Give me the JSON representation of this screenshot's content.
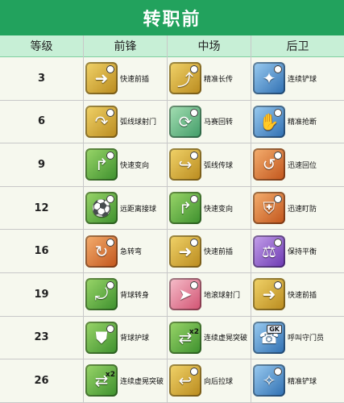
{
  "title": "转职前",
  "headers": {
    "level": "等级",
    "forward": "前锋",
    "midfield": "中场",
    "defense": "后卫"
  },
  "rows": [
    {
      "level": "3",
      "fw": {
        "label": "快速前插",
        "icon": "sprint-forward-icon",
        "color": "gold"
      },
      "mf": {
        "label": "精准长传",
        "icon": "long-pass-icon",
        "color": "gold"
      },
      "df": {
        "label": "连续铲球",
        "icon": "slide-tackle-icon",
        "color": "blue"
      }
    },
    {
      "level": "6",
      "fw": {
        "label": "弧线球射门",
        "icon": "curve-shot-icon",
        "color": "gold"
      },
      "mf": {
        "label": "马赛回转",
        "icon": "marseille-turn-icon",
        "color": "teal"
      },
      "df": {
        "label": "精准抢断",
        "icon": "steal-icon",
        "color": "blue"
      }
    },
    {
      "level": "9",
      "fw": {
        "label": "快速变向",
        "icon": "quick-turn-icon",
        "color": "green"
      },
      "mf": {
        "label": "弧线传球",
        "icon": "curve-pass-icon",
        "color": "gold"
      },
      "df": {
        "label": "迅速回位",
        "icon": "quick-return-icon",
        "color": "orange"
      }
    },
    {
      "level": "12",
      "fw": {
        "label": "远距离接球",
        "icon": "long-receive-icon",
        "color": "green"
      },
      "mf": {
        "label": "快速变向",
        "icon": "quick-turn-icon",
        "color": "green"
      },
      "df": {
        "label": "迅速盯防",
        "icon": "mark-icon",
        "color": "orange"
      }
    },
    {
      "level": "16",
      "fw": {
        "label": "急转弯",
        "icon": "sharp-turn-icon",
        "color": "orange"
      },
      "mf": {
        "label": "快速前插",
        "icon": "sprint-forward-icon",
        "color": "gold"
      },
      "df": {
        "label": "保持平衡",
        "icon": "balance-icon",
        "color": "purple"
      }
    },
    {
      "level": "19",
      "fw": {
        "label": "背球转身",
        "icon": "back-turn-icon",
        "color": "green"
      },
      "mf": {
        "label": "地滚球射门",
        "icon": "ground-shot-icon",
        "color": "pink"
      },
      "df": {
        "label": "快速前插",
        "icon": "sprint-forward-icon",
        "color": "gold"
      }
    },
    {
      "level": "23",
      "fw": {
        "label": "背球护球",
        "icon": "shield-ball-icon",
        "color": "green"
      },
      "mf": {
        "label": "连续虚晃突破",
        "icon": "double-feint-icon",
        "color": "green",
        "tag": "x2"
      },
      "df": {
        "label": "呼叫守门员",
        "icon": "call-keeper-icon",
        "color": "blue",
        "tagbox": "GK"
      }
    },
    {
      "level": "26",
      "fw": {
        "label": "连续虚晃突破",
        "icon": "double-feint-icon",
        "color": "green",
        "tag": "x2"
      },
      "mf": {
        "label": "向后拉球",
        "icon": "drag-back-icon",
        "color": "gold"
      },
      "df": {
        "label": "精准铲球",
        "icon": "precise-tackle-icon",
        "color": "blue"
      }
    }
  ]
}
